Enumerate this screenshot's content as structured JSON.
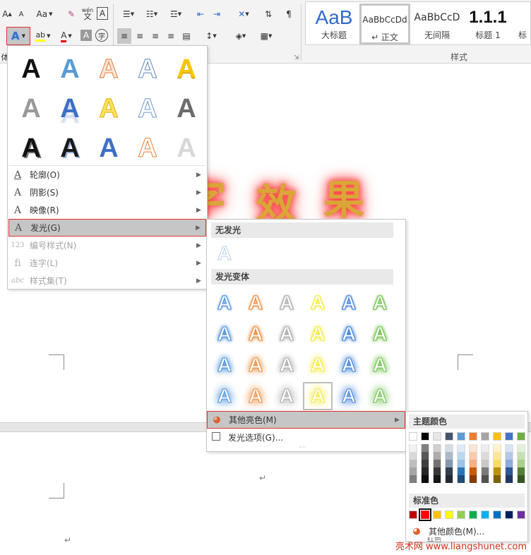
{
  "ribbon": {
    "tb_grow": "A",
    "tb_shrink": "A",
    "tb_case": "Aa",
    "tb_phonetic": "wén",
    "tb_phonetic2": "文",
    "tb_border_char": "A",
    "tb_highlight": "ab",
    "tb_fontcolor": "A",
    "tb_char_shade": "A",
    "tb_enclose": "字",
    "text_effects": "A",
    "clip_left": "体",
    "group_styles": "样式",
    "styles": [
      {
        "preview": "AaB",
        "name": "大标题"
      },
      {
        "preview": "AaBbCcDd",
        "name": "↵ 正文"
      },
      {
        "preview": "AaBbCcD",
        "name": "无间隔"
      },
      {
        "preview": "1.1.1",
        "name": "标题 1"
      },
      {
        "preview": "",
        "name": "标"
      }
    ]
  },
  "doc": {
    "deco_chars": [
      "字",
      "效",
      "果"
    ],
    "return_mark": "↵"
  },
  "effects_menu": {
    "gallery_letter": "A",
    "items": [
      {
        "icon": "A",
        "label": "轮廓(O)"
      },
      {
        "icon": "A",
        "label": "阴影(S)"
      },
      {
        "icon": "A",
        "label": "映像(R)"
      },
      {
        "icon": "A",
        "label": "发光(G)"
      },
      {
        "icon": "123",
        "label": "编号样式(N)"
      },
      {
        "icon": "fi",
        "label": "连字(L)"
      },
      {
        "icon": "abc",
        "label": "样式集(T)"
      }
    ]
  },
  "glow_submenu": {
    "no_glow_header": "无发光",
    "variants_header": "发光变体",
    "more_colors": "其他亮色(M)",
    "glow_options": "发光选项(G)...",
    "glow_colors": [
      "#4a8fdc",
      "#ed8a3c",
      "#a9a9a9",
      "#f4e93d",
      "#3c7cdb",
      "#6fc04c"
    ]
  },
  "color_picker": {
    "theme_header": "主题颜色",
    "standard_header": "标准色",
    "more_colors": "其他颜色(M)...",
    "tooltip": "红色",
    "theme_top": [
      "#ffffff",
      "#000000",
      "#e7e6e6",
      "#44546a",
      "#5b9bd5",
      "#ed7d31",
      "#a5a5a5",
      "#ffc000",
      "#4472c4",
      "#70ad47"
    ],
    "theme_columns": [
      [
        "#f2f2f2",
        "#d9d9d9",
        "#bfbfbf",
        "#a6a6a6",
        "#808080"
      ],
      [
        "#808080",
        "#595959",
        "#404040",
        "#262626",
        "#0d0d0d"
      ],
      [
        "#d0cece",
        "#aeabab",
        "#757171",
        "#3a3838",
        "#171616"
      ],
      [
        "#d6dce4",
        "#acb9ca",
        "#8497b0",
        "#333f4f",
        "#222a35"
      ],
      [
        "#deebf6",
        "#bdd7ee",
        "#9dc3e6",
        "#2e75b6",
        "#1f4e79"
      ],
      [
        "#fbe5d5",
        "#f8cbad",
        "#f4b183",
        "#c55a11",
        "#843c0c"
      ],
      [
        "#ededed",
        "#dbdbdb",
        "#c9c9c9",
        "#7b7b7b",
        "#525252"
      ],
      [
        "#fff2cc",
        "#ffe699",
        "#ffd966",
        "#bf9000",
        "#7f6000"
      ],
      [
        "#dae3f3",
        "#b4c7e7",
        "#8faadc",
        "#2f5597",
        "#203864"
      ],
      [
        "#e2f0d9",
        "#c5e0b4",
        "#a9d18e",
        "#538135",
        "#375623"
      ]
    ],
    "standard": [
      "#c00000",
      "#ff0000",
      "#ffc000",
      "#ffff00",
      "#92d050",
      "#00b050",
      "#00b0f0",
      "#0070c0",
      "#002060",
      "#7030a0"
    ]
  },
  "watermark": "亮术网 www.liangshunet.com"
}
